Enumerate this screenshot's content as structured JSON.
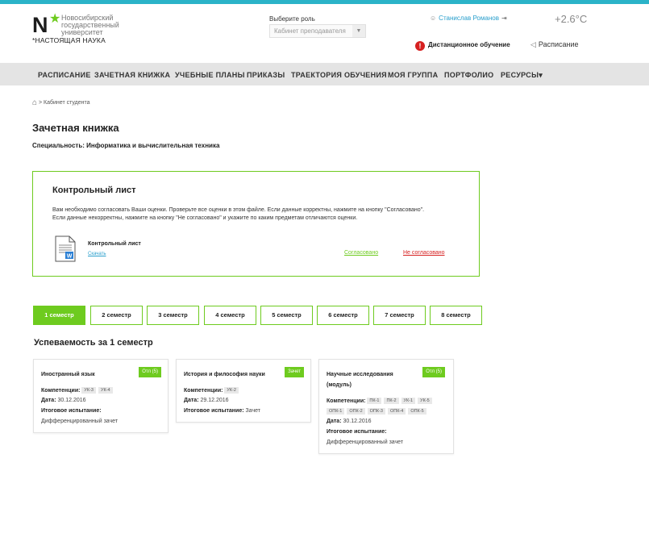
{
  "header": {
    "logo": {
      "letter": "N",
      "line1": "Новосибирский",
      "line2": "государственный",
      "line3": "университет",
      "tagline": "*НАСТОЯЩАЯ НАУКА"
    },
    "role_label": "Выберите роль",
    "role_value": "Кабинет преподавателя",
    "user_name": "Станислав Романов",
    "temperature": "+2.6°C",
    "distance_learning": "Дистанционное обучение",
    "schedule": "Расписание"
  },
  "nav": {
    "items": [
      "РАСПИСАНИЕ",
      "ЗАЧЕТНАЯ КНИЖКА",
      "УЧЕБНЫЕ ПЛАНЫ",
      "ПРИКАЗЫ",
      "ТРАЕКТОРИЯ ОБУЧЕНИЯ",
      "МОЯ ГРУППА",
      "ПОРТФОЛИО",
      "РЕСУРСЫ"
    ]
  },
  "breadcrumb": {
    "current": "Кабинет студента"
  },
  "page": {
    "title": "Зачетная книжка",
    "specialty": "Специальность: Информатика и вычислительная техника"
  },
  "control_sheet": {
    "title": "Контрольный лист",
    "description_line1": "Вам необходимо согласовать Ваши оценки. Проверьте все оценки в этом файле. Если данные корректны, нажмите на кнопку  \"Согласовано\".",
    "description_line2": "Если данные некорректны, нажмите на кнопку \"Не согласовано\" и укажите по каким предметам отличаются оценки.",
    "doc_name": "Контрольный лист",
    "download": "Скачать",
    "agree": "Согласовано",
    "disagree": "Не согласовано"
  },
  "semesters": {
    "tabs": [
      "1 семестр",
      "2 семестр",
      "3 семестр",
      "4 семестр",
      "5 семестр",
      "6 семестр",
      "7 семестр",
      "8 семестр"
    ],
    "active_index": 0
  },
  "performance": {
    "title": "Успеваемость за 1 семестр",
    "labels": {
      "competencies": "Компетенции:",
      "date": "Дата:",
      "final": "Итоговое испытание:"
    },
    "cards": [
      {
        "title": "Иностранный язык",
        "badge": "Отл (5)",
        "competencies": [
          "УК-3",
          "УК-4"
        ],
        "date": "30.12.2016",
        "final": "Дифференцированный зачет"
      },
      {
        "title": "История и философия науки",
        "badge": "Зачет",
        "competencies": [
          "УК-2"
        ],
        "date": "29.12.2016",
        "final": "Зачет"
      },
      {
        "title_line1": "Научные исследования",
        "title_line2": "(модуль)",
        "badge": "Отл (5)",
        "competencies_row1": [
          "ПК-1",
          "ПК-2",
          "УК-1",
          "УК-5"
        ],
        "competencies_row2": [
          "ОПК-1",
          "ОПК-2",
          "ОПК-3",
          "ОПК-4",
          "ОПК-5"
        ],
        "date": "30.12.2016",
        "final": "Дифференцированный зачет"
      }
    ]
  },
  "colors": {
    "accent_green": "#6ecb1f",
    "top_line": "#2bb3c8",
    "link_blue": "#2a9fcc",
    "alert_red": "#d62020",
    "nav_bg": "#e4e4e4"
  }
}
